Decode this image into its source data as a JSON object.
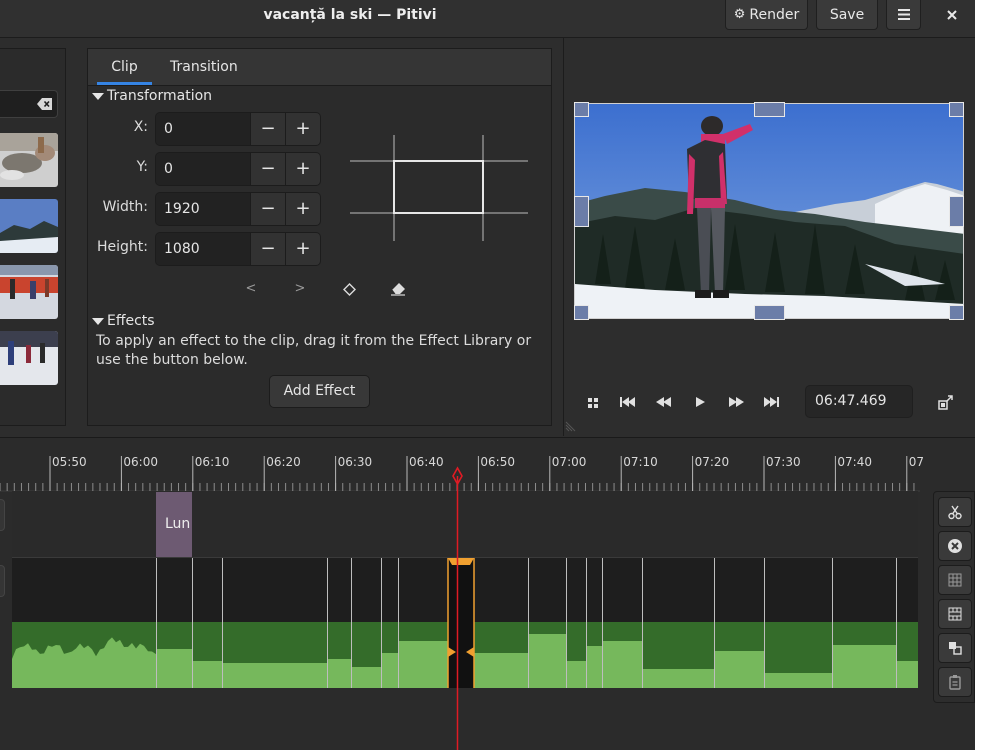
{
  "window": {
    "title": "vacanță la ski — Pitivi",
    "render_label": "Render",
    "save_label": "Save"
  },
  "clip_panel": {
    "tabs": [
      {
        "label": "Clip",
        "active": true
      },
      {
        "label": "Transition",
        "active": false
      }
    ],
    "transformation": {
      "heading": "Transformation",
      "fields": [
        {
          "label": "X:",
          "value": "0"
        },
        {
          "label": "Y:",
          "value": "0"
        },
        {
          "label": "Width:",
          "value": "1920"
        },
        {
          "label": "Height:",
          "value": "1080"
        }
      ],
      "minus": "−",
      "plus": "+",
      "prev_keyframe": "<",
      "next_keyframe": ">"
    },
    "effects": {
      "heading": "Effects",
      "help_text": "To apply an effect to the clip, drag it from the Effect Library or use the button below.",
      "add_label": "Add Effect"
    }
  },
  "viewer": {
    "timecode": "06:47.469"
  },
  "timeline": {
    "ruler_labels": [
      "05:50",
      "06:00",
      "06:10",
      "06:20",
      "06:30",
      "06:40",
      "06:50",
      "07:00",
      "07:10",
      "07:20",
      "07:30",
      "07:40",
      "07"
    ],
    "title_clip_label": "Lun",
    "playhead_time": "06:47.469"
  },
  "colors": {
    "accent": "#3584e4",
    "playhead": "#e01b24",
    "audio_dark": "#346c2a",
    "audio_light": "#76b85c",
    "title_clip": "#6d5a72",
    "selected_clip": "#f0a030"
  },
  "icons": [
    "gear-icon",
    "hamburger-menu-icon",
    "close-icon",
    "clear-search-icon",
    "keyframe-diamond-icon",
    "reset-eraser-icon",
    "grid-icon",
    "skip-start-icon",
    "rewind-icon",
    "play-icon",
    "fast-forward-icon",
    "skip-end-icon",
    "undock-icon",
    "scissors-icon",
    "delete-icon",
    "ungroup-icon",
    "group-icon",
    "align-icon",
    "paste-icon"
  ]
}
